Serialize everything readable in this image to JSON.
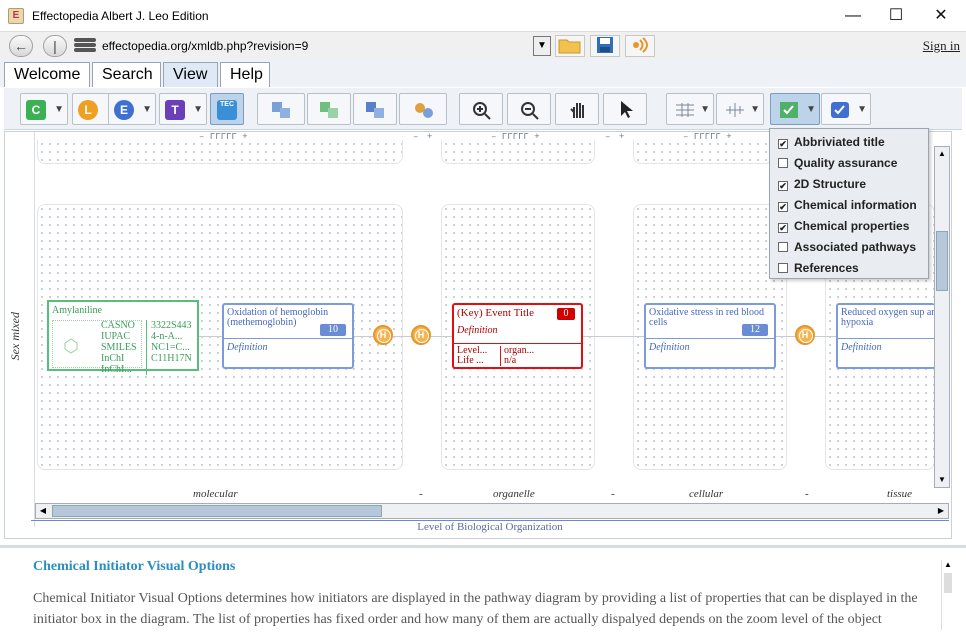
{
  "window": {
    "title": "Effectopedia  Albert J. Leo Edition",
    "minimize": "—",
    "maximize": "☐",
    "close": "✕"
  },
  "address": {
    "url": "effectopedia.org/xmldb.php?revision=9",
    "sign_in": "Sign in"
  },
  "tabs": [
    {
      "label": "Welcome"
    },
    {
      "label": "Search"
    },
    {
      "label": "View",
      "active": true
    },
    {
      "label": "Help"
    }
  ],
  "toolbar": {
    "c_label": "C",
    "l_label": "L",
    "e_label": "E",
    "t_label": "T",
    "tec_label": "TEC"
  },
  "columns": {
    "header_text": "– ΓΓΓΓΓ +",
    "minus": "–",
    "plus": "+"
  },
  "left_axis": {
    "label_primary": "Sex",
    "label_secondary": "mixed"
  },
  "initiator": {
    "title": "Amylaniline",
    "rows": [
      [
        "CASNO",
        "3322S443"
      ],
      [
        "IUPAC",
        "4-n-A..."
      ],
      [
        "SMILES",
        "NC1=C..."
      ],
      [
        "InChI",
        "C11H17N"
      ],
      [
        "InChI...",
        ""
      ]
    ]
  },
  "nodes": [
    {
      "title": "Oxidation of hemoglobin (methemoglobin)",
      "number": "10",
      "definition": "Definition"
    },
    {
      "title": "(Key) Event Title",
      "number": "0",
      "definition": "Definition",
      "level_label": "Level...",
      "life_label": "Life ...",
      "level_value": "organ...",
      "life_value": "n/a"
    },
    {
      "title": "Oxidative stress in red blood cells",
      "number": "12",
      "definition": "Definition"
    },
    {
      "title": "Reduced oxygen sup and hypoxia",
      "number": "",
      "definition": "Definition"
    }
  ],
  "hub_label": "H",
  "levels": [
    {
      "label": "molecular"
    },
    {
      "label": "-"
    },
    {
      "label": "organelle"
    },
    {
      "label": "-"
    },
    {
      "label": "cellular"
    },
    {
      "label": "-"
    },
    {
      "label": "tissue"
    }
  ],
  "axis_title": "Level of Biological Organization",
  "dropdown": {
    "items": [
      {
        "label": "Abbriviated title",
        "checked": true
      },
      {
        "label": "Quality assurance",
        "checked": false
      },
      {
        "label": "2D Structure",
        "checked": true
      },
      {
        "label": "Chemical information",
        "checked": true
      },
      {
        "label": "Chemical properties",
        "checked": true
      },
      {
        "label": "Associated pathways",
        "checked": false
      },
      {
        "label": "References",
        "checked": false
      }
    ],
    "check_glyph": "✔"
  },
  "help": {
    "heading": "Chemical Initiator Visual Options",
    "body": "Chemical Initiator Visual Options determines how initiators are displayed in the pathway diagram by providing a list of properties that can be displayed in the initiator box in the diagram. The list of properties has fixed order and how many of them are actually dispalyed depends on the zoom level of the object"
  }
}
